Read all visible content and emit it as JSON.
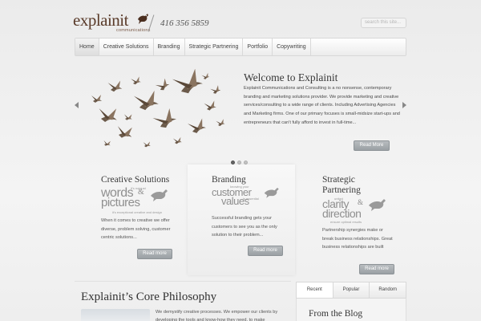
{
  "header": {
    "logo_text": "explainit",
    "logo_sub": "communications",
    "phone": "416 356 5859",
    "search_placeholder": "search this site..."
  },
  "nav": {
    "items": [
      {
        "label": "Home",
        "active": true
      },
      {
        "label": "Creative Solutions"
      },
      {
        "label": "Branding"
      },
      {
        "label": "Strategic Partnering"
      },
      {
        "label": "Portfolio"
      },
      {
        "label": "Copywriting"
      }
    ]
  },
  "slider": {
    "title": "Welcome to Explainit",
    "body": "Explainit Communications and Consulting is a no nonsense, contemporary branding and marketing solutions provider. We provide marketing and creative services/consulting to a wide range of clients. Including Advertising Agencies and Marketing firms. One of our primary focuses is small-midsize start-ups and entrepreneurs that can't fully afford to invest in full-time...",
    "read_more": "Read More",
    "dots": 3,
    "active_dot": 1
  },
  "features": [
    {
      "title": "Creative Solutions",
      "art": {
        "top": "it's not just",
        "word1": "words",
        "amp": "&",
        "word2": "pictures",
        "bottom": "it's exceptional creative and design"
      },
      "text": "When it comes to creative we offer diverse, problem solving, customer centric solutions...",
      "read_more": "Read more"
    },
    {
      "title": "Branding",
      "art": {
        "top": "knowing your",
        "word1": "customer",
        "amp": "",
        "word2": "values",
        "bottom": "is essential"
      },
      "text": "Successful branding gets your customers to see you as the only solution to their problem...",
      "read_more": "Read more"
    },
    {
      "title_line1": "Strategic",
      "title_line2": "Partnering",
      "art": {
        "top": "united",
        "word1": "clarity",
        "amp": "&",
        "word2": "direction",
        "bottom": "ensure optimal results"
      },
      "text": "Partnership synergies make or break business relationships. Great business relationships are built",
      "read_more": "Read more"
    }
  ],
  "philosophy": {
    "title": "Explainit’s Core Philosophy",
    "text": "We demystify creative processes. We empower our clients by developing the tools and know-how they need, to make"
  },
  "sidebar": {
    "tabs": [
      {
        "label": "Recent",
        "active": true
      },
      {
        "label": "Popular"
      },
      {
        "label": "Random"
      }
    ],
    "blog_title": "From the Blog"
  },
  "colors": {
    "brand_brown": "#5a3b2a",
    "button_gray": "#9aa0a4",
    "background": "#eeeeee"
  }
}
